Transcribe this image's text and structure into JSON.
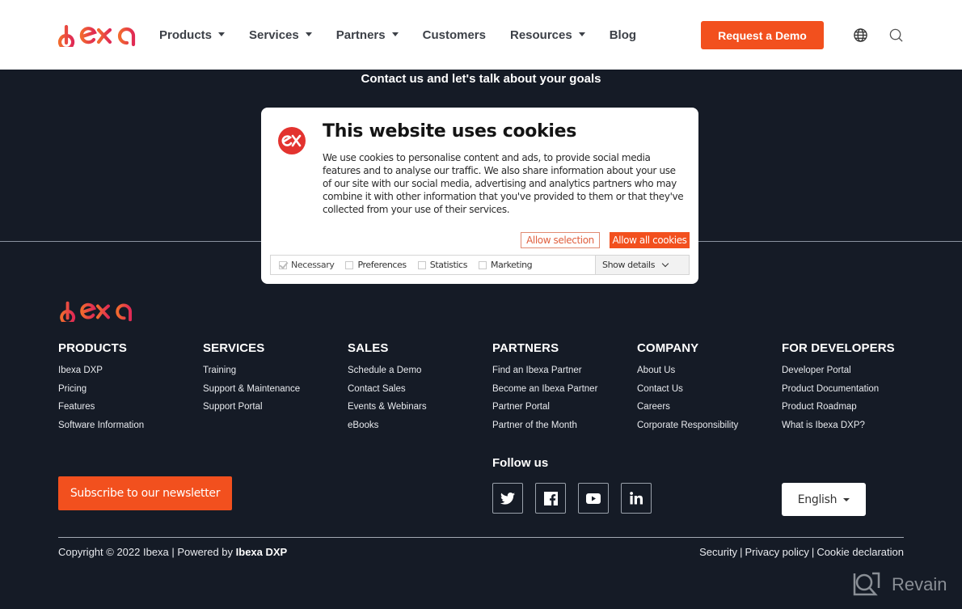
{
  "header": {
    "brand": "ibexa",
    "nav": [
      {
        "label": "Products",
        "has_dropdown": true
      },
      {
        "label": "Services",
        "has_dropdown": true
      },
      {
        "label": "Partners",
        "has_dropdown": true
      },
      {
        "label": "Customers",
        "has_dropdown": false
      },
      {
        "label": "Resources",
        "has_dropdown": true
      },
      {
        "label": "Blog",
        "has_dropdown": false
      }
    ],
    "cta_label": "Request a Demo",
    "icons": [
      "globe-icon",
      "search-icon"
    ]
  },
  "contact": {
    "text": "Contact us and let's talk about your goals"
  },
  "cookie_dialog": {
    "title": "This website uses cookies",
    "body": "We use cookies to personalise content and ads, to provide social media features and to analyse our traffic. We also share information about your use of our site with our social media, advertising and analytics partners who may combine it with other information that you've provided to them or that they've collected from your use of their services.",
    "allow_selection_label": "Allow selection",
    "allow_all_label": "Allow all cookies",
    "categories": [
      {
        "label": "Necessary",
        "checked": true,
        "disabled": true
      },
      {
        "label": "Preferences",
        "checked": false
      },
      {
        "label": "Statistics",
        "checked": false
      },
      {
        "label": "Marketing",
        "checked": false
      }
    ],
    "show_details_label": "Show details"
  },
  "footer": {
    "columns": [
      {
        "title": "PRODUCTS",
        "links": [
          "Ibexa DXP",
          "Pricing",
          "Features",
          "Software Information"
        ]
      },
      {
        "title": "SERVICES",
        "links": [
          "Training",
          "Support & Maintenance",
          "Support Portal"
        ]
      },
      {
        "title": "SALES",
        "links": [
          "Schedule a Demo",
          "Contact Sales",
          "Events & Webinars",
          "eBooks"
        ]
      },
      {
        "title": "PARTNERS",
        "links": [
          "Find an Ibexa Partner",
          "Become an Ibexa Partner",
          "Partner Portal",
          "Partner of the Month"
        ]
      },
      {
        "title": "COMPANY",
        "links": [
          "About Us",
          "Contact Us",
          "Careers",
          "Corporate Responsibility"
        ]
      },
      {
        "title": "FOR DEVELOPERS",
        "links": [
          "Developer Portal",
          "Product Documentation",
          "Product Roadmap",
          "What is Ibexa DXP?"
        ]
      }
    ],
    "subscribe_label": "Subscribe to our newsletter",
    "follow_label": "Follow us",
    "social": [
      "twitter",
      "facebook",
      "youtube",
      "linkedin"
    ],
    "language": "English",
    "copyright_prefix": "Copyright © 2022 Ibexa | Powered by ",
    "copyright_brand": "Ibexa DXP",
    "legal_links": [
      "Security",
      "Privacy policy",
      "Cookie declaration"
    ]
  },
  "watermark": {
    "text": "Revain"
  },
  "colors": {
    "accent": "#f2501e",
    "dark_bg": "#151b26",
    "header_bg": "#ffffff",
    "cookie_logo": "#e3332f"
  }
}
